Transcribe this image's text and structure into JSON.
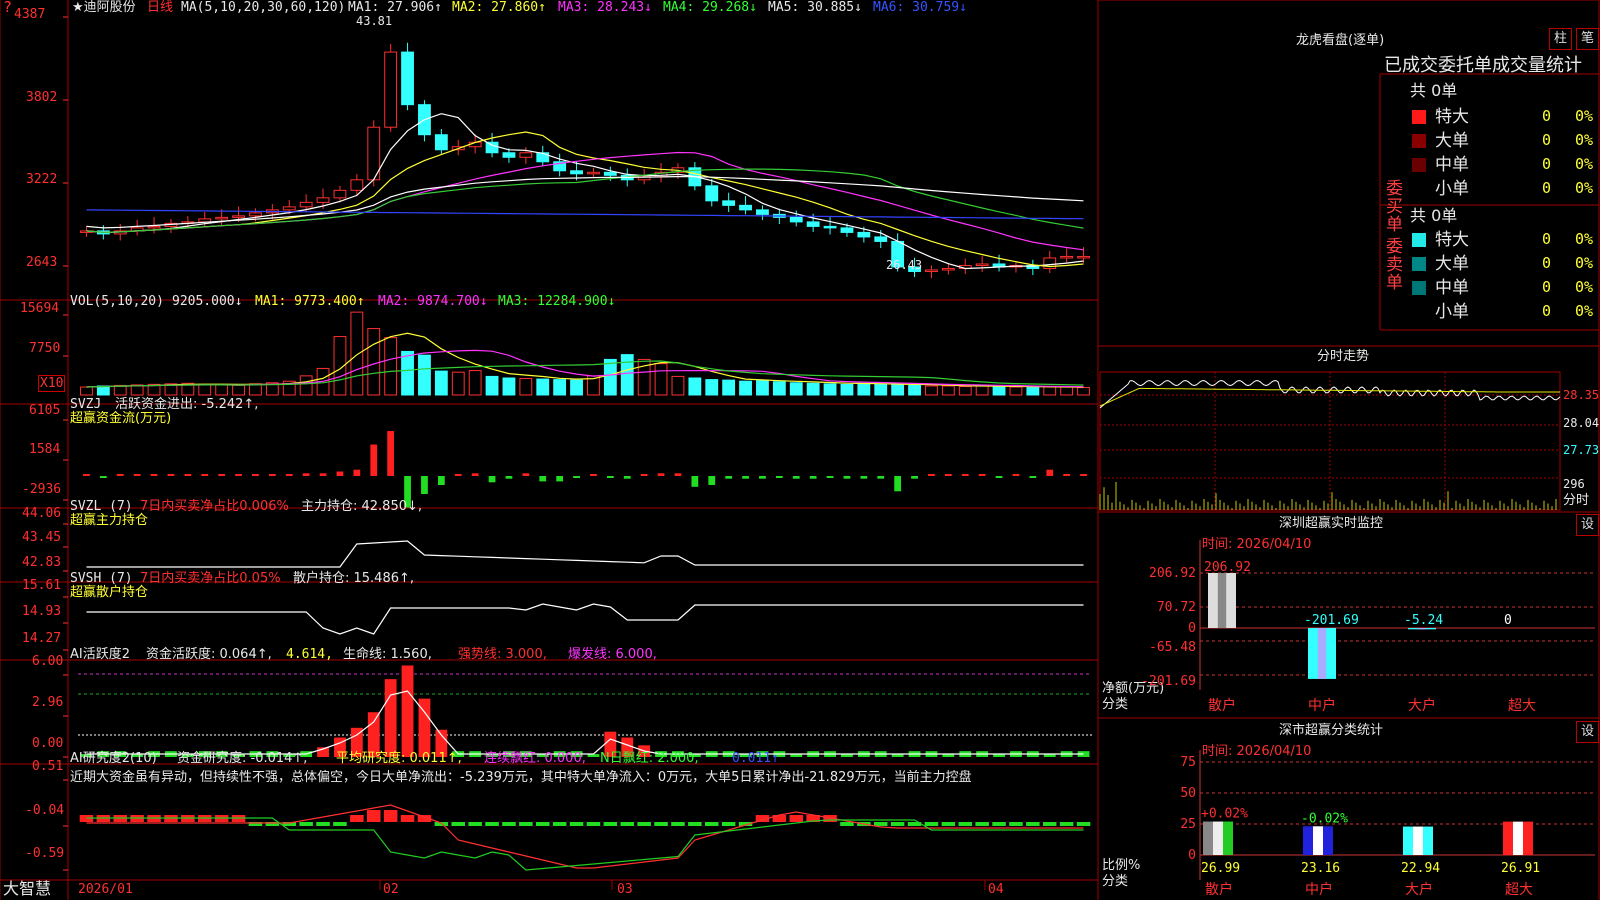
{
  "colors": {
    "up": "#ff3030",
    "down": "#33ffff",
    "grid": "#a00000",
    "ma1": "#ffffff",
    "ma2": "#ffff33",
    "ma3": "#ff33ff",
    "ma4": "#33cc33",
    "ma5": "#ffffff",
    "ma6": "#3344ff"
  },
  "kline": {
    "stock_name": "迪阿股份",
    "period": "日线",
    "ma_label": "MA(5,10,20,30,60,120)",
    "ma1": "MA1: 27.906↑",
    "ma2": "MA2: 27.860↑",
    "ma3": "MA3: 28.243↓",
    "ma4": "MA4: 29.268↓",
    "ma5": "MA5: 30.885↓",
    "ma6": "MA6: 30.759↓",
    "y_ticks": [
      "4387",
      "3802",
      "3222",
      "2643"
    ],
    "high_label": "43.81",
    "low_label": "26.43",
    "q_badge": "?"
  },
  "vol": {
    "label": "VOL(5,10,20)",
    "value": "9205.000↓",
    "ma1": "MA1: 9773.400↑",
    "ma2": "MA2: 9874.700↓",
    "ma3": "MA3: 12284.900↓",
    "y_ticks": [
      "15694",
      "7750"
    ],
    "unit": "X10"
  },
  "svzj": {
    "label": "SVZJ",
    "title": "活跃资金进出: -5.242↑,",
    "sub": "超赢资金流(万元)",
    "y_ticks": [
      "6105",
      "1584",
      "-2936"
    ]
  },
  "svzl": {
    "label": "SVZL (7)",
    "text1": "7日内买卖净占比0.006%",
    "text2": "主力持仓: 42.850↓,",
    "sub": "超赢主力持仓",
    "y_ticks": [
      "44.06",
      "43.45",
      "42.83"
    ]
  },
  "svsh": {
    "label": "SVSH (7)",
    "text1": "7日内买卖净占比0.05%",
    "text2": "散户持仓: 15.486↑,",
    "sub": "超赢散户持仓",
    "y_ticks": [
      "15.61",
      "14.93",
      "14.27"
    ]
  },
  "ai1": {
    "label": "AI活跃度2",
    "t1": "资金活跃度: 0.064↑,",
    "t2": "4.614,",
    "t3": "生命线: 1.560,",
    "t4": "强势线: 3.000,",
    "t5": "爆发线: 6.000,",
    "y_ticks": [
      "6.00",
      "2.96",
      "0.00"
    ]
  },
  "ai2": {
    "label": "AI研究度2(10)",
    "t1": "资金研究度: -0.014↑,",
    "t2": "平均研究度: 0.011↑,",
    "t3": "连续飘红: 0.000,",
    "t4": "N日飘红: 2.000,",
    "t5": "0.011↑",
    "comment": "近期大资金虽有异动，但持续性不强，总体偏空，今日大单净流出：-5.239万元，其中特大单净流入：0万元，大单5日累计净出-21.829万元，当前主力控盘",
    "y_ticks": [
      "0.51",
      "-0.04",
      "-0.59"
    ]
  },
  "xaxis": {
    "labels": [
      "2026/01",
      "02",
      "03",
      "04"
    ],
    "brand": "大智慧"
  },
  "dragon": {
    "title": "龙虎看盘(逐单)",
    "btn1": "柱",
    "btn2": "笔",
    "subtitle": "已成交委托单成交量统计",
    "buy": {
      "side": "委买单",
      "total": "共 0单",
      "rows": [
        {
          "name": "特大",
          "val": "0",
          "pct": "0%"
        },
        {
          "name": "大单",
          "val": "0",
          "pct": "0%"
        },
        {
          "name": "中单",
          "val": "0",
          "pct": "0%"
        },
        {
          "name": "小单",
          "val": "0",
          "pct": "0%"
        }
      ]
    },
    "sell": {
      "side": "委卖单",
      "total": "共 0单",
      "rows": [
        {
          "name": "特大",
          "val": "0",
          "pct": "0%"
        },
        {
          "name": "大单",
          "val": "0",
          "pct": "0%"
        },
        {
          "name": "中单",
          "val": "0",
          "pct": "0%"
        },
        {
          "name": "小单",
          "val": "0",
          "pct": "0%"
        }
      ]
    }
  },
  "intraday": {
    "title": "分时走势",
    "p1": "28.35",
    "p2": "28.04",
    "p3": "27.73",
    "vol": "296",
    "unit": "分时"
  },
  "monitor": {
    "title": "深圳超赢实时监控",
    "btn": "设",
    "time": "时间: 2026/04/10",
    "y_ticks": [
      "206.92",
      "70.72",
      "0",
      "-65.48",
      "-201.69"
    ],
    "ylabel": "净额(万元)",
    "xlabel": "分类",
    "bars": [
      {
        "name": "散户",
        "value": 206.92,
        "label": "206.92"
      },
      {
        "name": "中户",
        "value": -201.69,
        "label": "-201.69"
      },
      {
        "name": "大户",
        "value": -5.24,
        "label": "-5.24"
      },
      {
        "name": "超大",
        "value": 0,
        "label": "0"
      }
    ]
  },
  "classify": {
    "title": "深市超赢分类统计",
    "btn": "设",
    "time": "时间: 2026/04/10",
    "y_ticks": [
      "75",
      "50",
      "25",
      "0"
    ],
    "ylabel": "比例%",
    "xlabel": "分类",
    "bars": [
      {
        "name": "散户",
        "value": 26.99,
        "label": "26.99",
        "delta": "+0.02%"
      },
      {
        "name": "中户",
        "value": 23.16,
        "label": "23.16",
        "delta": "-0.02%"
      },
      {
        "name": "大户",
        "value": 22.94,
        "label": "22.94",
        "delta": ""
      },
      {
        "name": "超大",
        "value": 26.91,
        "label": "26.91",
        "delta": ""
      }
    ]
  }
}
